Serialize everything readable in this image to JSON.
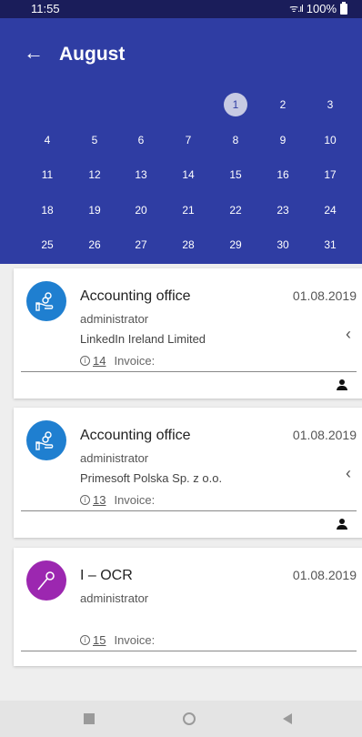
{
  "status_bar": {
    "time": "11:55",
    "signal": "ᯤ.ıl",
    "battery": "100%"
  },
  "header": {
    "title": "August"
  },
  "calendar": {
    "weeks": [
      [
        null,
        null,
        null,
        null,
        "1",
        "2",
        "3"
      ],
      [
        "4",
        "5",
        "6",
        "7",
        "8",
        "9",
        "10"
      ],
      [
        "11",
        "12",
        "13",
        "14",
        "15",
        "16",
        "17"
      ],
      [
        "18",
        "19",
        "20",
        "21",
        "22",
        "23",
        "24"
      ],
      [
        "25",
        "26",
        "27",
        "28",
        "29",
        "30",
        "31"
      ]
    ],
    "selected": "1"
  },
  "cards": [
    {
      "title": "Accounting office",
      "date": "01.08.2019",
      "role": "administrator",
      "company": "LinkedIn Ireland Limited",
      "count": "14",
      "invoice_label": "Invoice:",
      "avatar_color": "#1f7fd0",
      "avatar_icon": "hand-coin-icon",
      "has_chevron": true,
      "has_person": true
    },
    {
      "title": "Accounting office",
      "date": "01.08.2019",
      "role": "administrator",
      "company": "Primesoft Polska Sp. z o.o.",
      "count": "13",
      "invoice_label": "Invoice:",
      "avatar_color": "#1f7fd0",
      "avatar_icon": "hand-coin-icon",
      "has_chevron": true,
      "has_person": true
    },
    {
      "title": "I – OCR",
      "date": "01.08.2019",
      "role": "administrator",
      "company": "",
      "count": "15",
      "invoice_label": "Invoice:",
      "avatar_color": "#9c27b0",
      "avatar_icon": "magnifier-icon",
      "has_chevron": false,
      "has_person": false
    }
  ],
  "colors": {
    "header": "#2f3da3",
    "status_bar": "#1a1d5a"
  }
}
